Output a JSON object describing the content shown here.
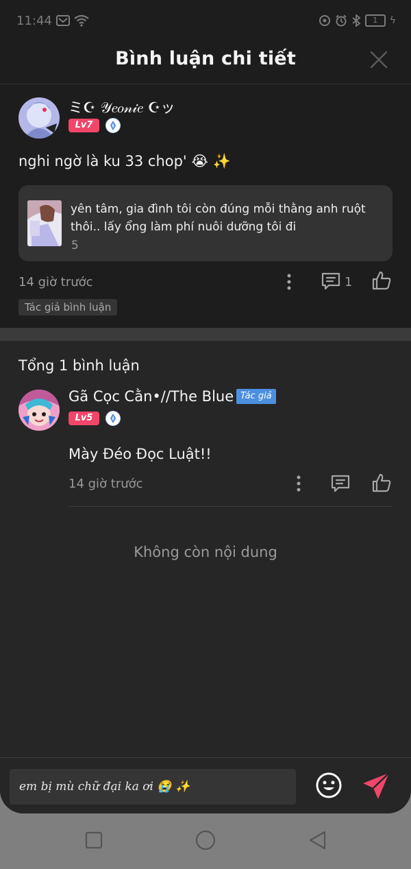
{
  "status_bar": {
    "time": "11:44",
    "battery": "1"
  },
  "header": {
    "title": "Bình luận chi tiết"
  },
  "main_comment": {
    "author": "ミ☪ 𝒴𝑒𝑜𝓃𝒾𝑒 ☪ッ",
    "level": "Lv7",
    "text": "nghi ngờ là ku 33 chop' 😭 ✨",
    "quote": {
      "text": "yên tâm, gia đình tôi còn đúng mỗi thằng anh ruột thôi.. lấy ổng làm phí nuôi dưỡng tôi đi",
      "count": "5"
    },
    "time": "14 giờ trước",
    "reply_count": "1",
    "author_tag": "Tác giả bình luận"
  },
  "replies_section": {
    "total_label": "Tổng 1 bình luận",
    "replies": [
      {
        "author": "Gã Cọc Cằn•//The Blue",
        "author_badge": "Tác giả",
        "level": "Lv5",
        "text": "Mày Đéo Đọc Luật!!",
        "time": "14 giờ trước"
      }
    ],
    "no_more": "Không còn nội dung"
  },
  "composer": {
    "value": "em bị mù chữ đại ka ơi 😭 ✨"
  },
  "colors": {
    "accent": "#f0466a",
    "author_badge": "#4b8fe0",
    "background": "#262626",
    "card": "#1d1d1d"
  }
}
